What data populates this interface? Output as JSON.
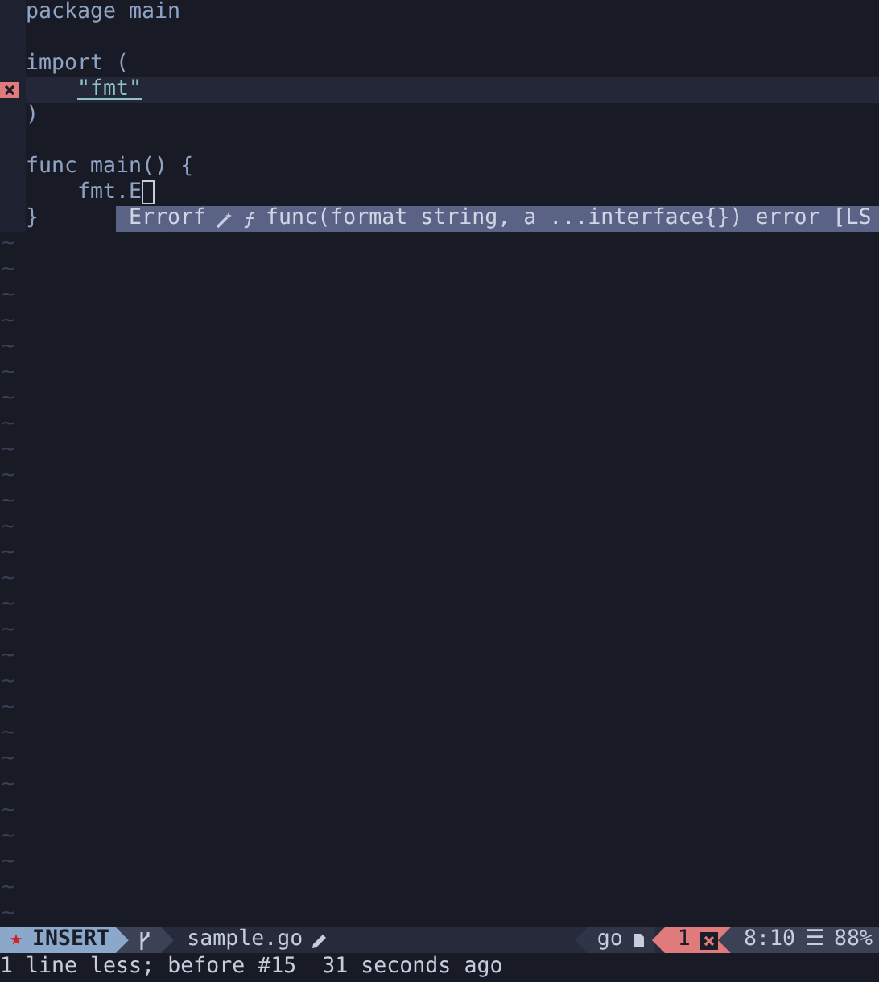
{
  "editor": {
    "lines": [
      {
        "error": false,
        "highlighted": false,
        "indented": false,
        "tokens": [
          {
            "kind": "plain",
            "text": "package main"
          }
        ]
      },
      {
        "error": false,
        "highlighted": false
      },
      {
        "error": false,
        "highlighted": false,
        "indented": false,
        "tokens": [
          {
            "kind": "plain",
            "text": "import ("
          }
        ]
      },
      {
        "error": true,
        "highlighted": true,
        "indented": true,
        "tokens": [
          {
            "kind": "string",
            "text": "\"fmt\""
          }
        ]
      },
      {
        "error": false,
        "highlighted": false,
        "indented": false,
        "tokens": [
          {
            "kind": "plain",
            "text": ")"
          }
        ]
      },
      {
        "error": false,
        "highlighted": false
      },
      {
        "error": false,
        "highlighted": false,
        "indented": false,
        "tokens": [
          {
            "kind": "plain",
            "text": "func main() {"
          }
        ]
      },
      {
        "error": false,
        "highlighted": false,
        "indented": true,
        "cursor": true,
        "tokens": [
          {
            "kind": "plain",
            "text": "fmt.E"
          }
        ]
      },
      {
        "error": false,
        "highlighted": false,
        "indented": false,
        "tokens": [
          {
            "kind": "plain",
            "text": "}"
          }
        ]
      }
    ],
    "completion": {
      "word": "Errorf",
      "detail": "func(format string, a ...interface{}) error [LS"
    },
    "tildes": [
      "~",
      "~",
      "~",
      "~",
      "~",
      "~",
      "~",
      "~",
      "~",
      "~",
      "~",
      "~",
      "~",
      "~",
      "~",
      "~",
      "~",
      "~",
      "~",
      "~",
      "~",
      "~",
      "~",
      "~",
      "~",
      "~",
      "~"
    ]
  },
  "status_bar": {
    "mode_icon": "★",
    "mode": "INSERT",
    "filename": "sample.go",
    "modified": true,
    "filetype": "go",
    "errors": "1",
    "position": "8:10",
    "lines_icon": "☰",
    "percent": "88%"
  },
  "message": "1 line less; before #15  31 seconds ago"
}
